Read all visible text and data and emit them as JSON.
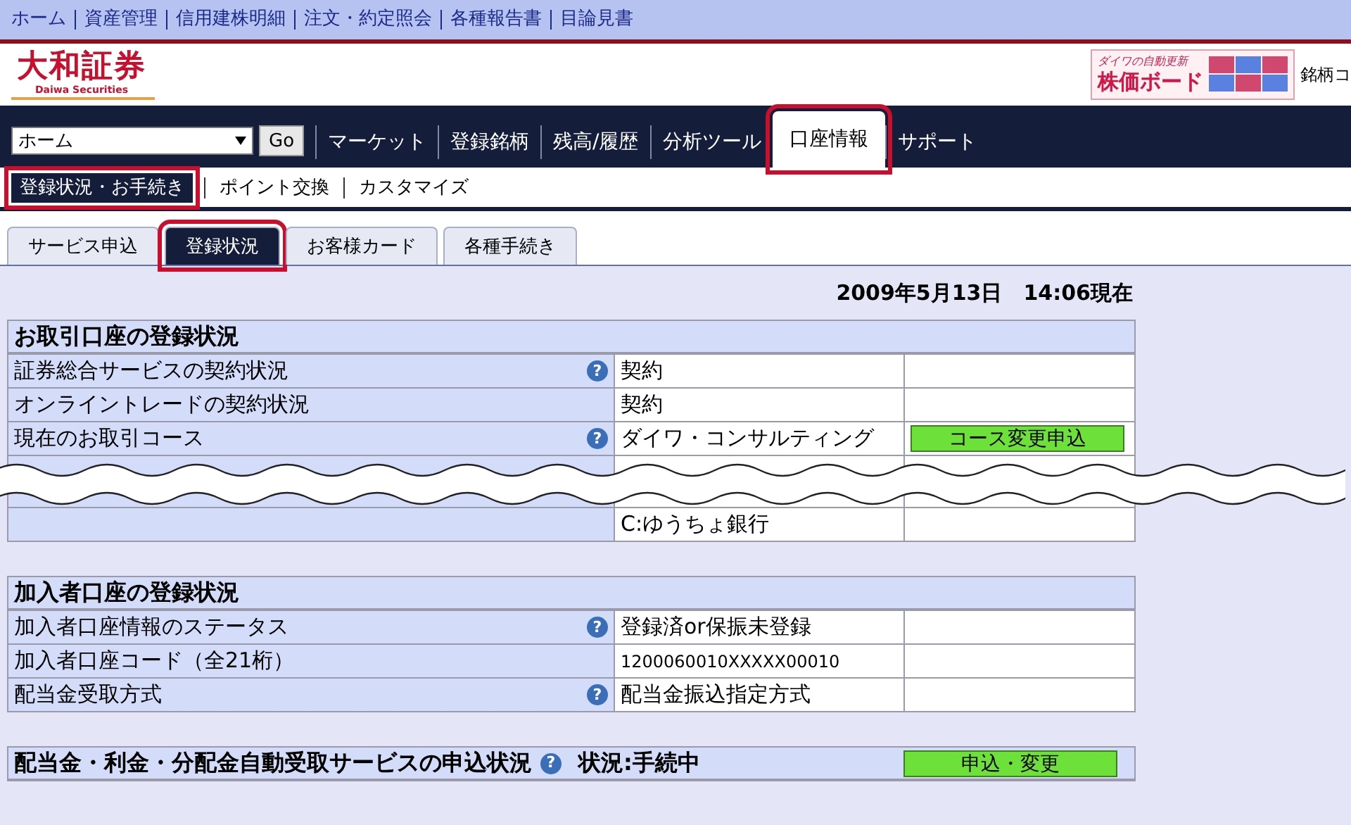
{
  "top_links": [
    "ホーム",
    "資産管理",
    "信用建株明細",
    "注文・約定照会",
    "各種報告書",
    "目論見書"
  ],
  "logo": {
    "name": "大和証券",
    "subtitle": "Daiwa Securities"
  },
  "banner": {
    "caption": "ダイワの自動更新",
    "title": "株価ボード"
  },
  "header_cut_text": "銘柄コ",
  "nav": {
    "select_value": "ホーム",
    "go_button": "Go",
    "items": [
      {
        "label": "マーケット",
        "selected": false,
        "highlighted": false
      },
      {
        "label": "登録銘柄",
        "selected": false,
        "highlighted": false
      },
      {
        "label": "残高/履歴",
        "selected": false,
        "highlighted": false
      },
      {
        "label": "分析ツール",
        "selected": false,
        "highlighted": false
      },
      {
        "label": "口座情報",
        "selected": true,
        "highlighted": true
      },
      {
        "label": "サポート",
        "selected": false,
        "highlighted": false
      }
    ]
  },
  "subnav": [
    {
      "label": "登録状況・お手続き",
      "selected": true,
      "highlighted": true
    },
    {
      "label": "ポイント交換",
      "selected": false,
      "highlighted": false
    },
    {
      "label": "カスタマイズ",
      "selected": false,
      "highlighted": false
    }
  ],
  "tabs": [
    {
      "label": "サービス申込",
      "selected": false,
      "highlighted": false
    },
    {
      "label": "登録状況",
      "selected": true,
      "highlighted": true
    },
    {
      "label": "お客様カード",
      "selected": false,
      "highlighted": false
    },
    {
      "label": "各種手続き",
      "selected": false,
      "highlighted": false
    }
  ],
  "timestamp": "2009年5月13日　14:06現在",
  "sections": [
    {
      "title": "お取引口座の登録状況",
      "rows": [
        {
          "kind": "row",
          "label": "証券総合サービスの契約状況",
          "help": "?",
          "value": "契約"
        },
        {
          "kind": "row",
          "label": "オンライントレードの契約状況",
          "value": "契約"
        },
        {
          "kind": "row",
          "label": "現在のお取引コース",
          "help": "?",
          "value": "ダイワ・コンサルティング",
          "action": "コース変更申込"
        },
        {
          "kind": "cut"
        },
        {
          "kind": "row",
          "value": "C:ゆうちょ銀行"
        }
      ]
    },
    {
      "title": "加入者口座の登録状況",
      "rows": [
        {
          "kind": "row",
          "label": "加入者口座情報のステータス",
          "help": "?",
          "value": "登録済or保振未登録"
        },
        {
          "kind": "row",
          "label": "加入者口座コード（全21桁）",
          "value": "1200060010XXXXX00010",
          "small": true
        },
        {
          "kind": "row",
          "label": "配当金受取方式",
          "help": "?",
          "value": "配当金振込指定方式"
        }
      ]
    },
    {
      "title": "配当金・利金・分配金自動受取サービスの申込状況",
      "help": "?",
      "status": "状況:手続中",
      "action": "申込・変更"
    }
  ]
}
